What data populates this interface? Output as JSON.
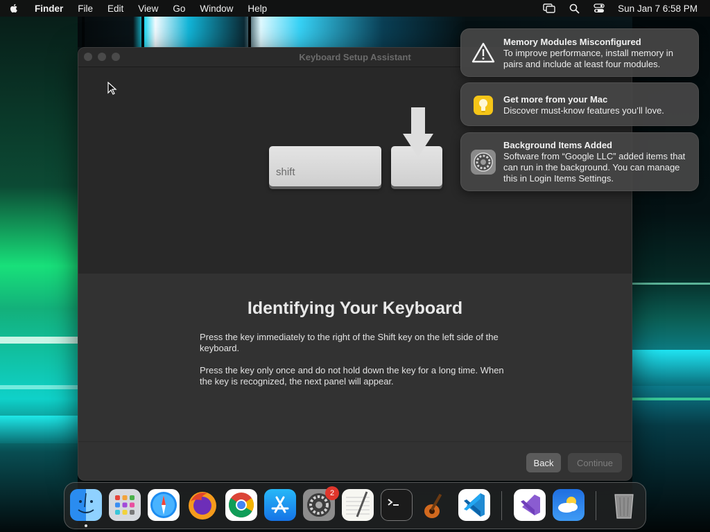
{
  "menubar": {
    "app_name": "Finder",
    "menus": [
      "File",
      "Edit",
      "View",
      "Go",
      "Window",
      "Help"
    ],
    "datetime": "Sun Jan 7  6:58 PM"
  },
  "window": {
    "title": "Keyboard Setup Assistant",
    "key_label": "shift",
    "heading": "Identifying Your Keyboard",
    "paragraph1": "Press the key immediately to the right of the Shift key on the left side of the keyboard.",
    "paragraph2": "Press the key only once and do not hold down the key for a long time. When the key is recognized, the next panel will appear.",
    "back_label": "Back",
    "continue_label": "Continue"
  },
  "notifications": [
    {
      "title": "Memory Modules Misconfigured",
      "body": "To improve performance, install memory in pairs and include at least four modules.",
      "icon": "warning-icon"
    },
    {
      "title": "Get more from your Mac",
      "body": "Discover must-know features you’ll love.",
      "icon": "lightbulb-icon"
    },
    {
      "title": "Background Items Added",
      "body": "Software from “Google LLC” added items that can run in the background. You can manage this in Login Items Settings.",
      "icon": "settings-gear-icon"
    }
  ],
  "dock": {
    "apps": [
      "finder",
      "launchpad",
      "safari",
      "firefox",
      "chrome",
      "app-store",
      "system-settings",
      "textedit",
      "terminal",
      "garageband",
      "vscode",
      "visual-studio",
      "weather",
      "trash"
    ],
    "system_settings_badge": "2"
  }
}
